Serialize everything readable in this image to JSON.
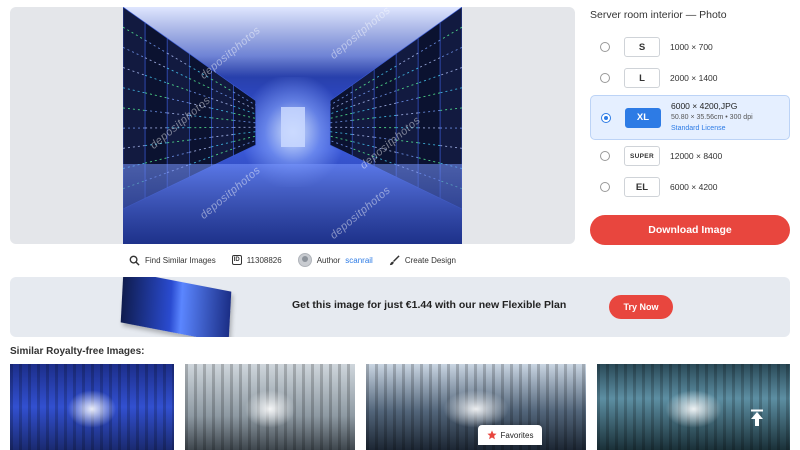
{
  "preview": {
    "watermark": "depositphotos"
  },
  "meta": {
    "find_similar": "Find Similar Images",
    "id_badge": "ID",
    "image_id": "11308826",
    "author_label": "Author",
    "author_name": "scanrail",
    "create_design": "Create Design"
  },
  "panel": {
    "title": "Server room interior — Photo",
    "sizes": [
      {
        "code": "S",
        "dims": "1000 × 700"
      },
      {
        "code": "L",
        "dims": "2000 × 1400"
      },
      {
        "code": "XL",
        "dims": "6000 × 4200,JPG",
        "detail": "50.80 × 35.56cm • 300 dpi",
        "license": "Standard License",
        "selected": true
      },
      {
        "code": "SUPER",
        "dims": "12000 × 8400"
      },
      {
        "code": "EL",
        "dims": "6000 × 4200"
      }
    ],
    "download_label": "Download Image"
  },
  "promo": {
    "text": "Get this image for just €1.44 with our new Flexible Plan",
    "button": "Try Now"
  },
  "similar": {
    "heading": "Similar Royalty-free Images:"
  },
  "favorites": {
    "label": "Favorites"
  },
  "colors": {
    "accent_red": "#e8463e",
    "accent_blue": "#2d7be5",
    "selected_bg": "#e5efff"
  }
}
